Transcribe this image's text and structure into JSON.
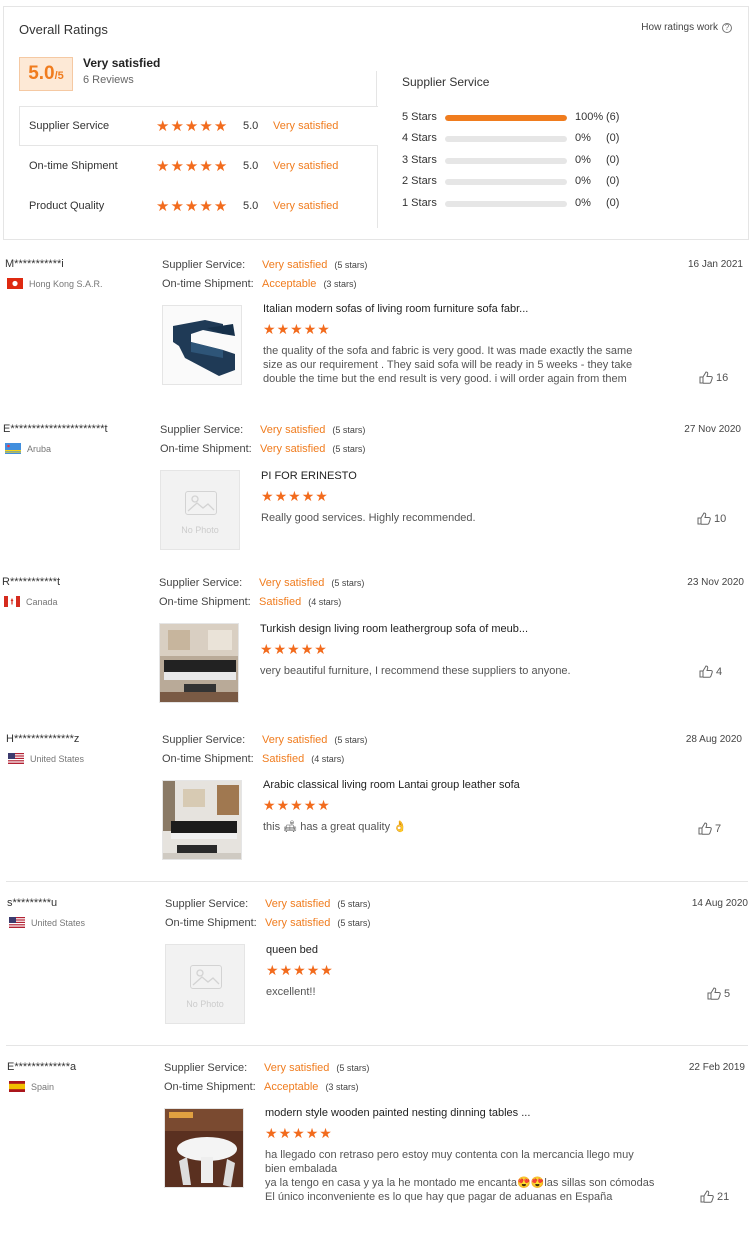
{
  "header": {
    "title": "Overall Ratings",
    "how_ratings_work": "How ratings work",
    "score_main": "5.0",
    "score_out_of": "/5",
    "satisfaction": "Very satisfied",
    "reviews_count": "6 Reviews"
  },
  "categories": [
    {
      "label": "Supplier Service",
      "score": "5.0",
      "satisfaction": "Very satisfied",
      "stars": 5,
      "selected": true
    },
    {
      "label": "On-time Shipment",
      "score": "5.0",
      "satisfaction": "Very satisfied",
      "stars": 5,
      "selected": false
    },
    {
      "label": "Product Quality",
      "score": "5.0",
      "satisfaction": "Very satisfied",
      "stars": 5,
      "selected": false
    }
  ],
  "distribution": {
    "title": "Supplier Service",
    "rows": [
      {
        "label": "5 Stars",
        "fraction": 1.0,
        "pct": "100%",
        "count": "(6)"
      },
      {
        "label": "4 Stars",
        "fraction": 0,
        "pct": "0%",
        "count": "(0)"
      },
      {
        "label": "3 Stars",
        "fraction": 0,
        "pct": "0%",
        "count": "(0)"
      },
      {
        "label": "2 Stars",
        "fraction": 0,
        "pct": "0%",
        "count": "(0)"
      },
      {
        "label": "1 Stars",
        "fraction": 0,
        "pct": "0%",
        "count": "(0)"
      }
    ]
  },
  "labels": {
    "supplier_service": "Supplier Service:",
    "on_time_shipment": "On-time Shipment:",
    "no_photo": "No Photo"
  },
  "colors": {
    "accent": "#f07c1e",
    "star": "#f26b1d"
  },
  "reviews": [
    {
      "name": "M***********i",
      "country": "Hong Kong S.A.R.",
      "flag": "hong-kong-flag",
      "date": "16 Jan 2021",
      "supplier_service": "Very satisfied",
      "supplier_service_stars": "(5 stars)",
      "shipment": "Acceptable",
      "shipment_stars": "(3 stars)",
      "product_title": "Italian modern sofas of living room furniture sofa fabr...",
      "product_stars": 5,
      "text": "the quality of the sofa and fabric is very good. It was made exactly the same size as our requirement .  They said sofa will be ready in 5 weeks - they take double the time but the end result is very good.  i will order again from them",
      "likes": "16",
      "image": "sofa-photo"
    },
    {
      "name": "E**********************t",
      "country": "Aruba",
      "flag": "aruba-flag",
      "date": "27 Nov 2020",
      "supplier_service": "Very satisfied",
      "supplier_service_stars": "(5 stars)",
      "shipment": "Very satisfied",
      "shipment_stars": "(5 stars)",
      "product_title": "PI FOR ERINESTO",
      "product_stars": 5,
      "text": "Really good services. Highly recommended.",
      "likes": "10",
      "image": "no-photo"
    },
    {
      "name": "R***********t",
      "country": "Canada",
      "flag": "canada-flag",
      "date": "23 Nov 2020",
      "supplier_service": "Very satisfied",
      "supplier_service_stars": "(5 stars)",
      "shipment": "Satisfied",
      "shipment_stars": "(4 stars)",
      "product_title": "Turkish design living room leathergroup sofa of meub...",
      "product_stars": 5,
      "text": "very beautiful furniture, I recommend these suppliers to anyone.",
      "likes": "4",
      "image": "leather-sofa-photo"
    },
    {
      "name": "H**************z",
      "country": "United States",
      "flag": "us-flag",
      "date": "28 Aug 2020",
      "supplier_service": "Very satisfied",
      "supplier_service_stars": "(5 stars)",
      "shipment": "Satisfied",
      "shipment_stars": "(4 stars)",
      "product_title": "Arabic classical living room Lantai group leather sofa",
      "product_stars": 5,
      "text": "this 🛋 has a great quality 👌",
      "likes": "7",
      "image": "classical-sofa-photo"
    },
    {
      "name": "s*********u",
      "country": "United States",
      "flag": "us-flag",
      "date": "14 Aug 2020",
      "supplier_service": "Very satisfied",
      "supplier_service_stars": "(5 stars)",
      "shipment": "Very satisfied",
      "shipment_stars": "(5 stars)",
      "product_title": "queen bed",
      "product_stars": 5,
      "text": "excellent!!",
      "likes": "5",
      "image": "no-photo"
    },
    {
      "name": "E*************a",
      "country": "Spain",
      "flag": "spain-flag",
      "date": "22 Feb 2019",
      "supplier_service": "Very satisfied",
      "supplier_service_stars": "(5 stars)",
      "shipment": "Acceptable",
      "shipment_stars": "(3 stars)",
      "product_title": "modern style wooden painted nesting dinning tables ...",
      "product_stars": 5,
      "text": "ha llegado con retraso pero estoy muy contenta con la mercancia llego muy bien embalada\nya la tengo en casa y ya la he montado me encanta😍😍las sillas son cómodas\nEl único inconveniente es lo que hay que pagar de aduanas en España",
      "likes": "21",
      "image": "dining-table-photo"
    }
  ]
}
